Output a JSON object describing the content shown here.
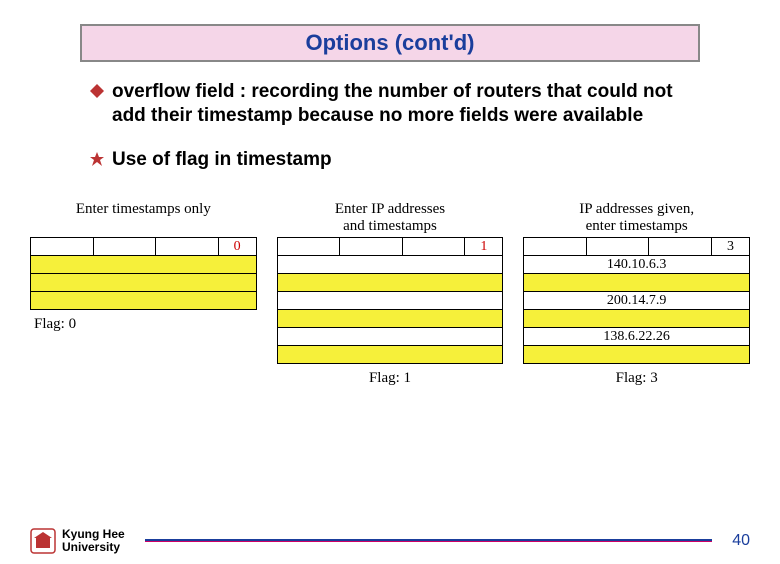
{
  "title": "Options (cont'd)",
  "bullets": {
    "b1": "overflow field : recording the number of routers that could not add their timestamp because no more fields were available",
    "b2": "Use of flag in timestamp"
  },
  "diagrams": {
    "d1": {
      "top": "Enter timestamps only",
      "flagval": "0",
      "caption": "Flag: 0"
    },
    "d2": {
      "top_l1": "Enter IP addresses",
      "top_l2": "and timestamps",
      "flagval": "1",
      "caption": "Flag: 1"
    },
    "d3": {
      "top_l1": "IP addresses given,",
      "top_l2": "enter timestamps",
      "flagval": "3",
      "ip1": "140.10.6.3",
      "ip2": "200.14.7.9",
      "ip3": "138.6.22.26",
      "caption": "Flag: 3"
    }
  },
  "footer": {
    "uni_l1": "Kyung Hee",
    "uni_l2": "University",
    "page": "40"
  },
  "colors": {
    "title_bg": "#f5d6e8",
    "title_fg": "#1a3e9c",
    "highlight": "#f6f03a",
    "flagval": "#c00"
  }
}
